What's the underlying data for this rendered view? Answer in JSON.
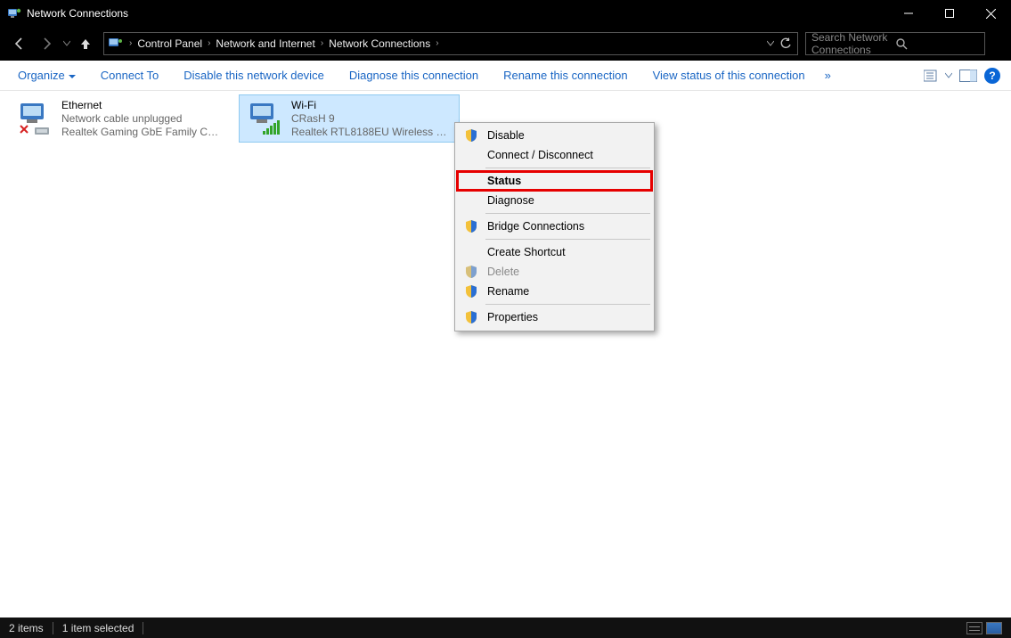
{
  "window": {
    "title": "Network Connections"
  },
  "breadcrumbs": {
    "items": [
      "Control Panel",
      "Network and Internet",
      "Network Connections"
    ]
  },
  "search": {
    "placeholder": "Search Network Connections"
  },
  "toolbar": {
    "organize": "Organize",
    "connect_to": "Connect To",
    "disable": "Disable this network device",
    "diagnose": "Diagnose this connection",
    "rename": "Rename this connection",
    "view_status": "View status of this connection",
    "more_glyph": "»"
  },
  "adapters": {
    "ethernet": {
      "name": "Ethernet",
      "status": "Network cable unplugged",
      "device": "Realtek Gaming GbE Family Contr..."
    },
    "wifi": {
      "name": "Wi-Fi",
      "ssid": "CRasH 9",
      "device": "Realtek RTL8188EU Wireless LAN 8..."
    }
  },
  "context_menu": {
    "disable": "Disable",
    "connect_disconnect": "Connect / Disconnect",
    "status": "Status",
    "diagnose": "Diagnose",
    "bridge": "Bridge Connections",
    "create_shortcut": "Create Shortcut",
    "delete": "Delete",
    "rename": "Rename",
    "properties": "Properties"
  },
  "statusbar": {
    "count": "2 items",
    "selected": "1 item selected"
  },
  "help_glyph": "?"
}
